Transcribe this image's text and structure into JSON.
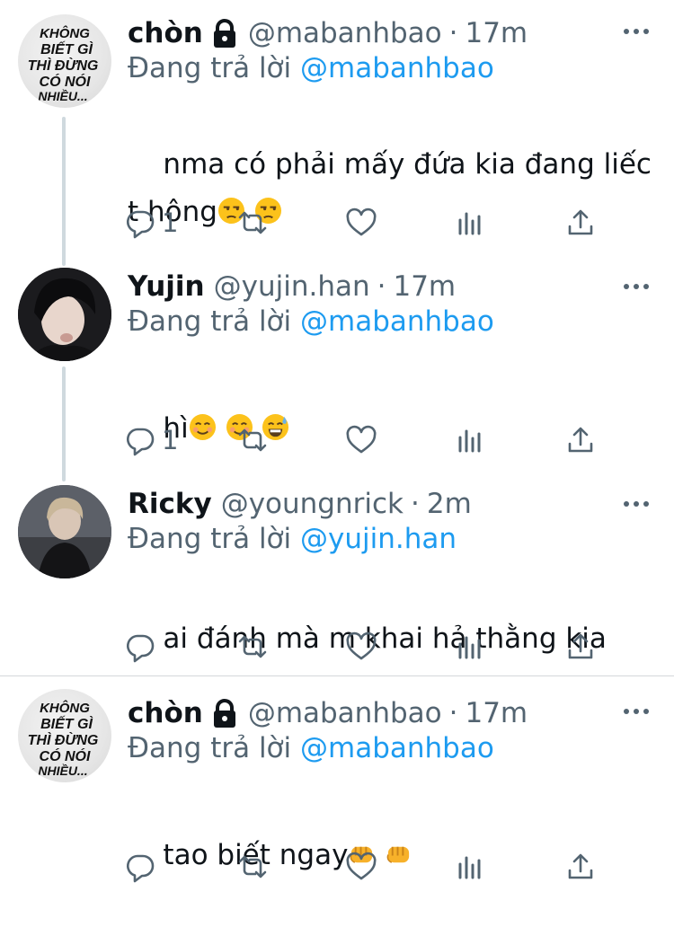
{
  "reply_prefix": "Đang trả lời",
  "icons": [
    "lock-icon",
    "more-icon",
    "reply-icon",
    "retweet-icon",
    "like-icon",
    "analytics-icon",
    "share-icon"
  ],
  "colors": {
    "link": "#1d9bf0",
    "muted": "#536471",
    "text": "#0f1419"
  },
  "tweets": [
    {
      "avatar_text": [
        "KHÔNG",
        "BIẾT GÌ",
        "THÌ ĐỪNG",
        "CÓ NÓI",
        "NHIỀU..."
      ],
      "name": "chòn",
      "handle": "@mabanhbao",
      "time": "17m",
      "reply_to": "@mabanhbao",
      "text_line1": "nma có phải mấy đứa kia đang liếc",
      "text_line2": "t hông",
      "reply_count": "1"
    },
    {
      "name": "Yujin",
      "handle": "@yujin.han",
      "time": "17m",
      "reply_to": "@mabanhbao",
      "text": "hì",
      "reply_count": "1"
    },
    {
      "name": "Ricky",
      "handle": "@youngnrick",
      "time": "2m",
      "reply_to": "@yujin.han",
      "text": "ai đánh mà m khai hả thằng kia",
      "reply_count": ""
    },
    {
      "avatar_text": [
        "KHÔNG",
        "BIẾT GÌ",
        "THÌ ĐỪNG",
        "CÓ NÓI",
        "NHIỀU..."
      ],
      "name": "chòn",
      "handle": "@mabanhbao",
      "time": "17m",
      "reply_to": "@mabanhbao",
      "text": "tao biết ngay",
      "reply_count": ""
    }
  ]
}
